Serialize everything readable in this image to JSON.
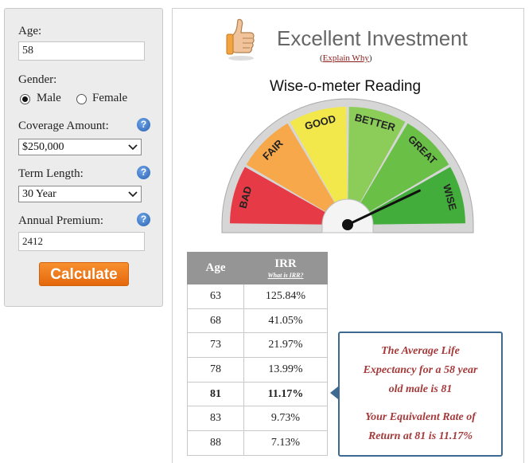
{
  "form": {
    "age_label": "Age:",
    "age_value": "58",
    "gender_label": "Gender:",
    "gender_options": [
      "Male",
      "Female"
    ],
    "gender_selected": "Male",
    "coverage_label": "Coverage Amount:",
    "coverage_value": "$250,000",
    "term_label": "Term Length:",
    "term_value": "30 Year",
    "premium_label": "Annual Premium:",
    "premium_value": "2412",
    "help_glyph": "?",
    "calculate_label": "Calculate"
  },
  "result": {
    "verdict": "Excellent Investment",
    "explain_open": "(",
    "explain_link": "Explain Why",
    "explain_close": ")",
    "meter_title": "Wise-o-meter Reading",
    "gauge_labels": [
      "BAD",
      "FAIR",
      "GOOD",
      "BETTER",
      "GREAT",
      "WISE"
    ],
    "gauge_colors": [
      "#e63a46",
      "#f6a84a",
      "#f2e84b",
      "#8ccd5a",
      "#6abf46",
      "#43ad3b"
    ],
    "needle_reading": "WISE",
    "icon": "thumbs-up-icon"
  },
  "table": {
    "col_age": "Age",
    "col_irr": "IRR",
    "col_irr_link": "What is IRR?",
    "rows": [
      {
        "age": "63",
        "irr": "125.84%"
      },
      {
        "age": "68",
        "irr": "41.05%"
      },
      {
        "age": "73",
        "irr": "21.97%"
      },
      {
        "age": "78",
        "irr": "13.99%"
      },
      {
        "age": "81",
        "irr": "11.17%"
      },
      {
        "age": "83",
        "irr": "9.73%"
      },
      {
        "age": "88",
        "irr": "7.13%"
      }
    ],
    "highlight_age": "81"
  },
  "callout": {
    "line1": "The Average Life",
    "line2": "Expectancy for a 58 year",
    "line3": "old male is 81",
    "line4": "Your Equivalent Rate of",
    "line5": "Return at 81 is 11.17%"
  }
}
